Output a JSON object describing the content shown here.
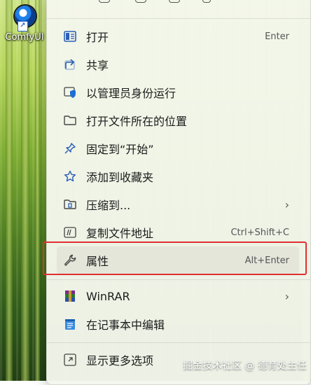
{
  "desktop": {
    "icon_label": "ComfyUI"
  },
  "menu": {
    "items": [
      {
        "label": "打开",
        "shortcut": "Enter"
      },
      {
        "label": "共享",
        "shortcut": ""
      },
      {
        "label": "以管理员身份运行",
        "shortcut": ""
      },
      {
        "label": "打开文件所在的位置",
        "shortcut": ""
      },
      {
        "label": "固定到“开始”",
        "shortcut": ""
      },
      {
        "label": "添加到收藏夹",
        "shortcut": ""
      },
      {
        "label": "压缩到...",
        "shortcut": ""
      },
      {
        "label": "复制文件地址",
        "shortcut": "Ctrl+Shift+C"
      },
      {
        "label": "属性",
        "shortcut": "Alt+Enter"
      },
      {
        "label": "WinRAR",
        "shortcut": ""
      },
      {
        "label": "在记事本中编辑",
        "shortcut": ""
      },
      {
        "label": "显示更多选项",
        "shortcut": ""
      }
    ],
    "submenu_chevron": "›",
    "highlight_color": "#e03030"
  },
  "watermark": "掘金技术社区 @ 德育处主任"
}
